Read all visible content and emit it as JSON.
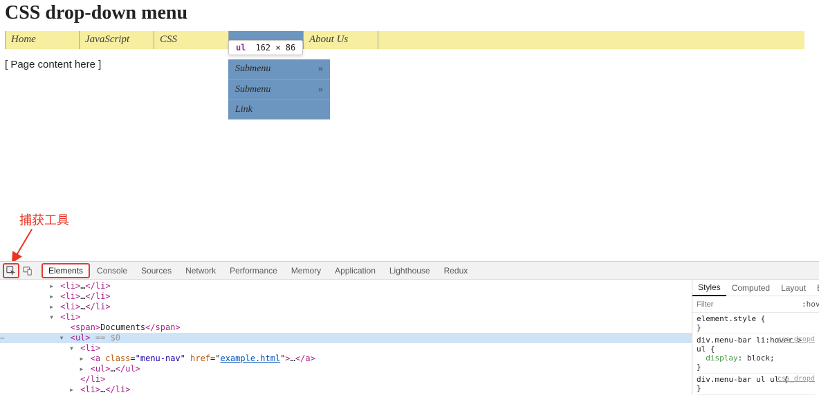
{
  "page": {
    "title": "CSS drop-down menu",
    "content_text": "[ Page content here ]"
  },
  "annotation": {
    "label": "捕获工具"
  },
  "menu": {
    "items": [
      {
        "label": "Home"
      },
      {
        "label": "JavaScript"
      },
      {
        "label": "CSS"
      },
      {
        "label": ""
      },
      {
        "label": "About Us"
      }
    ],
    "submenu": [
      {
        "label": "Submenu",
        "has_children": true
      },
      {
        "label": "Submenu",
        "has_children": true
      },
      {
        "label": "Link",
        "has_children": false
      }
    ]
  },
  "inspect_tooltip": {
    "tag": "ul",
    "dims": "162 × 86"
  },
  "devtools": {
    "tabs": [
      "Elements",
      "Console",
      "Sources",
      "Network",
      "Performance",
      "Memory",
      "Application",
      "Lighthouse",
      "Redux"
    ],
    "active_tab": "Elements",
    "dom": {
      "rows": [
        {
          "indent": 3,
          "tri": "▸",
          "html": "<li>…</li>"
        },
        {
          "indent": 3,
          "tri": "▸",
          "html": "<li>…</li>"
        },
        {
          "indent": 3,
          "tri": "▸",
          "html": "<li>…</li>"
        },
        {
          "indent": 3,
          "tri": "▾",
          "html": "<li>"
        },
        {
          "indent": 4,
          "tri": "",
          "html": "<span>Documents</span>"
        },
        {
          "indent": 4,
          "tri": "▾",
          "html": "<ul>",
          "hl": true,
          "suffix": " == $0"
        },
        {
          "indent": 5,
          "tri": "▾",
          "html": "<li>"
        },
        {
          "indent": 6,
          "tri": "▸",
          "html": "<a class=\"menu-nav\" href=\"example.html\">…</a>"
        },
        {
          "indent": 6,
          "tri": "▸",
          "html": "<ul>…</ul>"
        },
        {
          "indent": 5,
          "tri": "",
          "html": "</li>"
        },
        {
          "indent": 5,
          "tri": "▸",
          "html": "<li>…</li>"
        }
      ]
    },
    "styles": {
      "tabs": [
        "Styles",
        "Computed",
        "Layout",
        "E"
      ],
      "active": "Styles",
      "filter_placeholder": "Filter",
      "hov": ":hov",
      "rules": [
        {
          "selector": "element.style",
          "origin": "",
          "decls": []
        },
        {
          "selector": "div.menu-bar li:hover > ul",
          "origin": "css_dropd",
          "decls": [
            {
              "n": "display",
              "v": "block"
            }
          ]
        },
        {
          "selector": "div.menu-bar ul ul",
          "origin": "css_dropd",
          "decls": []
        }
      ]
    }
  }
}
